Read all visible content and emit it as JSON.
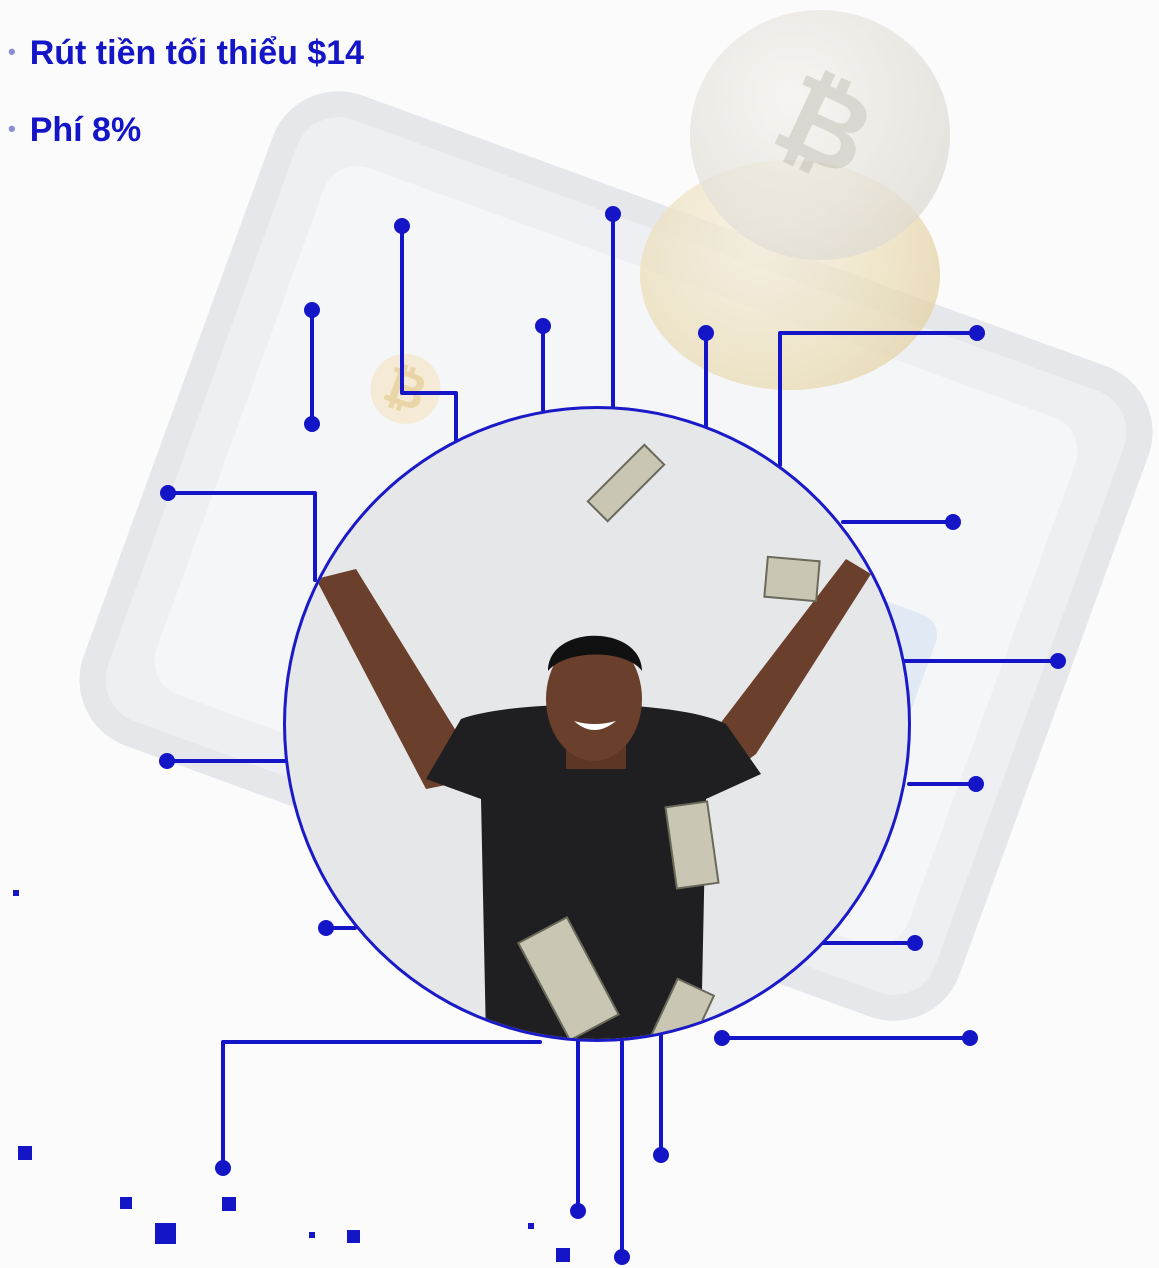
{
  "features": {
    "partial": "...",
    "items": [
      {
        "label": "Rút tiền tối thiểu $14"
      },
      {
        "label": "Phí 8%"
      }
    ]
  },
  "colors": {
    "accent": "#1515c8",
    "bullet": "#8a8fd8"
  },
  "photo": {
    "subject": "smiling man throwing dollar bills"
  },
  "icons": [
    "bitcoin-icon",
    "bullet-dot-icon"
  ]
}
